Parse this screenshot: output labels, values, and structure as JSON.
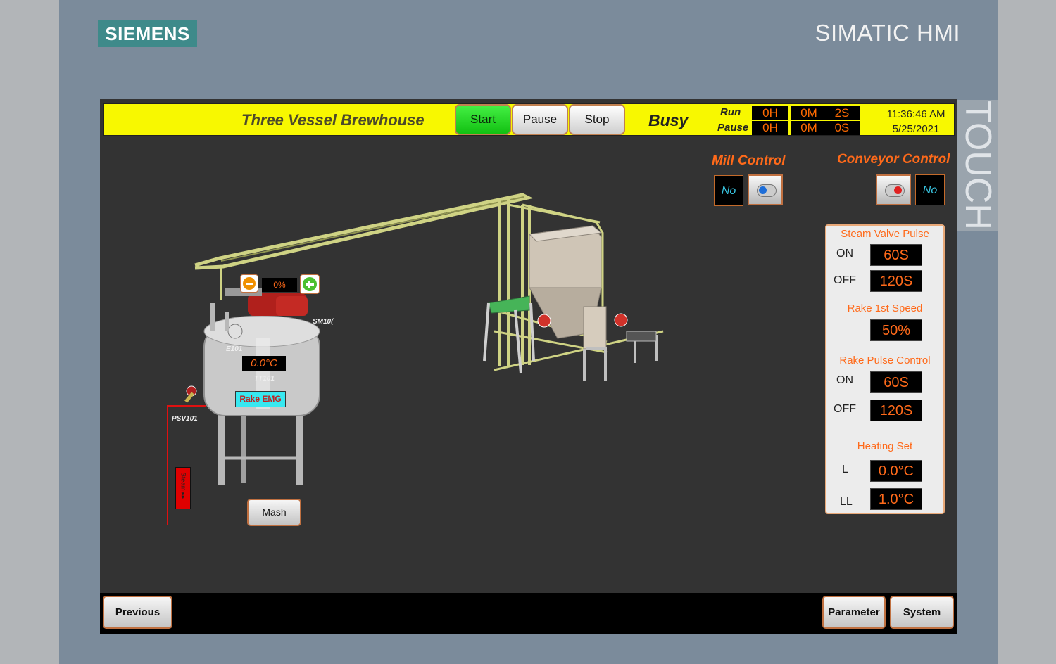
{
  "bezel": {
    "brand": "SIEMENS",
    "product": "SIMATIC HMI",
    "edge_label": "TOUCH"
  },
  "header": {
    "title": "Three Vessel Brewhouse",
    "start_label": "Start",
    "pause_label": "Pause",
    "stop_label": "Stop",
    "status": "Busy",
    "run_label": "Run",
    "pause_time_label": "Pause",
    "run_time": {
      "h": "0H",
      "m": "0M",
      "s": "2S"
    },
    "pause_time": {
      "h": "0H",
      "m": "0M",
      "s": "0S"
    },
    "time": "11:36:46 AM",
    "date": "5/25/2021"
  },
  "mill_control": {
    "title": "Mill Control",
    "state": "No"
  },
  "conveyor_control": {
    "title": "Conveyor Control",
    "state": "No"
  },
  "panel": {
    "steam_valve_pulse": {
      "title": "Steam Valve Pulse",
      "on_label": "ON",
      "on_value": "60S",
      "off_label": "OFF",
      "off_value": "120S"
    },
    "rake_first_speed": {
      "title": "Rake 1st Speed",
      "value": "50%"
    },
    "rake_pulse_control": {
      "title": "Rake Pulse  Control",
      "on_label": "ON",
      "on_value": "60S",
      "off_label": "OFF",
      "off_value": "120S"
    },
    "heating_set": {
      "title": "Heating Set",
      "l_label": "L",
      "l_value": "0.0°C",
      "ll_label": "LL",
      "ll_value": "1.0°C"
    }
  },
  "tank": {
    "speed_value": "0%",
    "motor_tag": "SM10(",
    "vessel_tag": "E101",
    "temperature": "0.0°C",
    "temp_tag": "TT101",
    "rake_emg": "Rake EMG",
    "valve_tag": "PSV101",
    "steam_label": "Steam ▸▸",
    "mash_button": "Mash"
  },
  "footer": {
    "previous": "Previous",
    "parameter": "Parameter",
    "system": "System"
  },
  "colors": {
    "accent": "#ff6a1a",
    "header": "#f8f800",
    "screen": "#333333",
    "start": "#22dd22"
  }
}
